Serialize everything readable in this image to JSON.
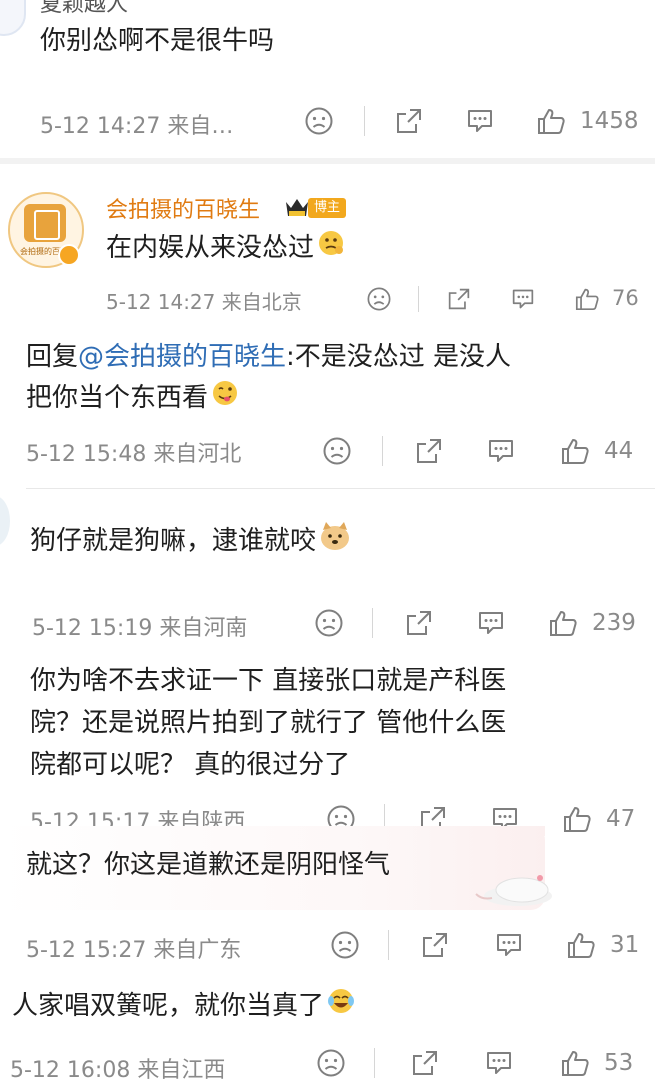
{
  "c1": {
    "name_partial": "夏颖越人",
    "text": "你别怂啊不是很牛吗",
    "meta": "5-12 14:27 来自…",
    "likes": "1458"
  },
  "c2": {
    "name": "会拍摄的百晓生",
    "badge": "博主",
    "avatar_caption": "会拍摄的百晓",
    "text": "在内娱从来没怂过",
    "meta": "5-12 14:27 来自北京",
    "likes": "76"
  },
  "c3": {
    "reply_prefix": "回复",
    "mention": "@会拍摄的百晓生",
    "text_line1": ":不是没怂过 是没人",
    "text_line2": "把你当个东西看",
    "meta": "5-12 15:48 来自河北",
    "likes": "44"
  },
  "c4": {
    "text": "狗仔就是狗嘛，逮谁就咬",
    "meta": "5-12 15:19 来自河南",
    "likes": "239"
  },
  "c5": {
    "line1": "你为啥不去求证一下 直接张口就是产科医",
    "line2": "院？还是说照片拍到了就行了 管他什么医",
    "line3": "院都可以呢？ 真的很过分了",
    "meta": "5-12 15:17 来自陕西",
    "likes": "47"
  },
  "c6": {
    "text": "就这？你这是道歉还是阴阳怪气",
    "meta": "5-12 15:27 来自广东",
    "likes": "31"
  },
  "c7": {
    "text": "人家唱双簧呢，就你当真了",
    "meta": "5-12 16:08 来自江西",
    "likes": "53"
  },
  "icons": [
    "sad-face-icon",
    "share-icon",
    "comment-icon",
    "thumbs-up-icon"
  ],
  "colors": {
    "name": "#e07b12",
    "mention": "#2f6db5",
    "meta": "#8a8a8a",
    "badge": "#f2a81d"
  }
}
